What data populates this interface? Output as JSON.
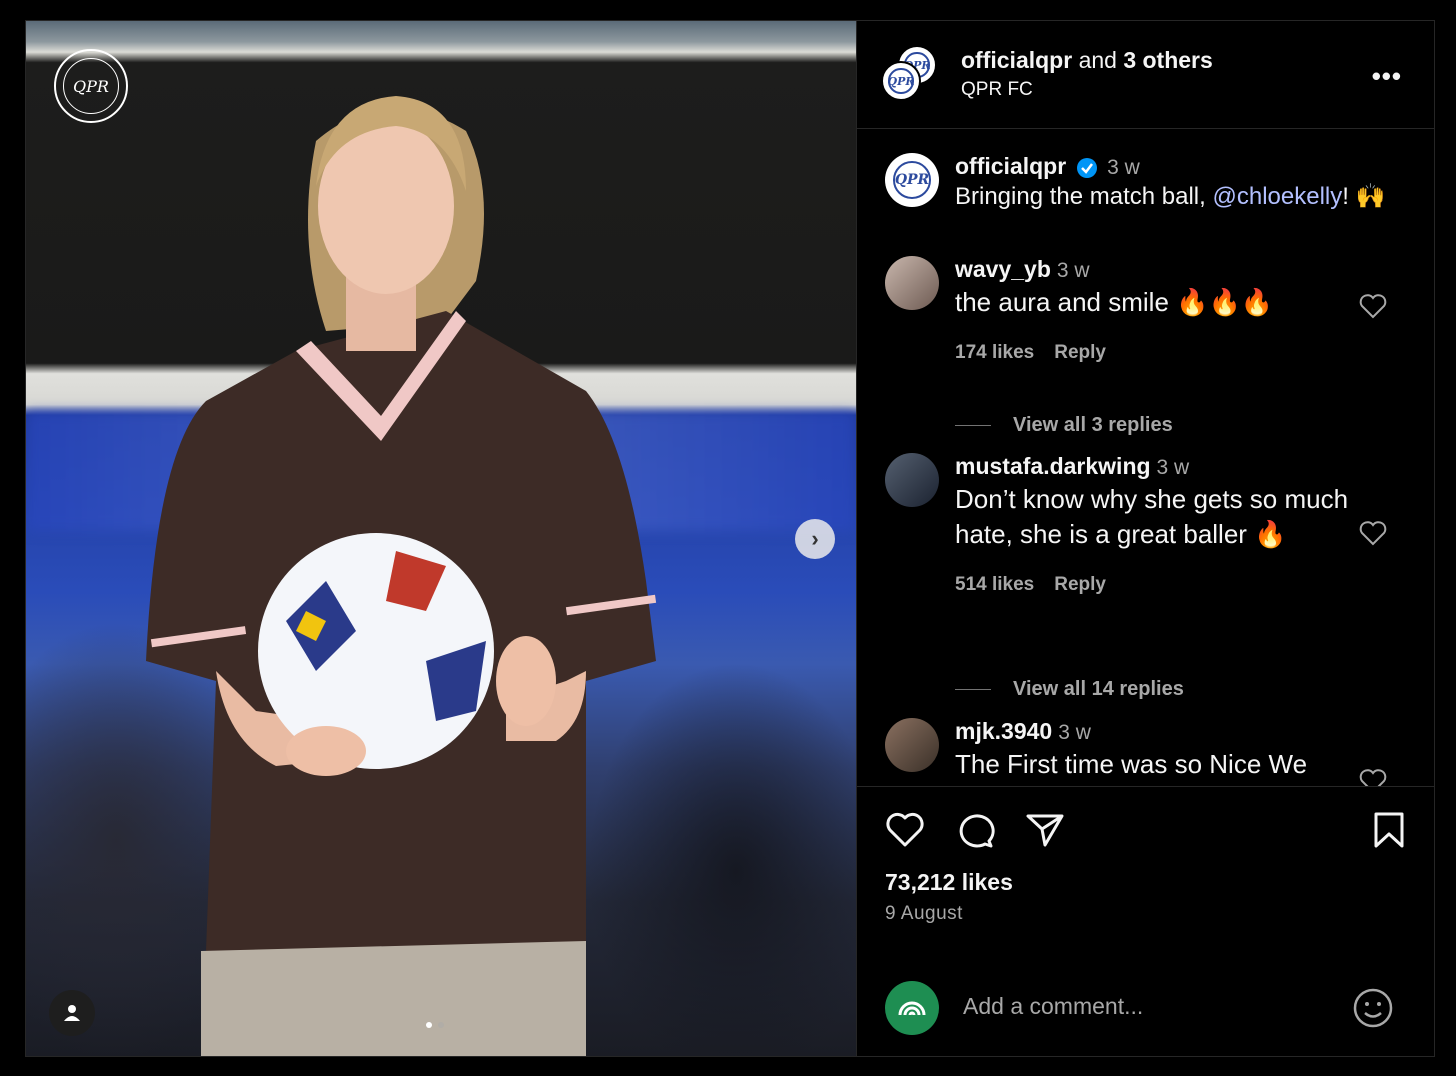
{
  "post": {
    "header": {
      "username": "officialqpr",
      "and_text": "and",
      "others": "3 others",
      "subtitle": "QPR FC"
    },
    "caption": {
      "username": "officialqpr",
      "time": "3 w",
      "text_before": "Bringing the match ball, ",
      "mention": "@chloekelly",
      "text_after": "! 🙌"
    },
    "comments": [
      {
        "username": "wavy_yb",
        "time": "3 w",
        "text": "the aura and smile 🔥🔥🔥",
        "likes": "174 likes",
        "reply": "Reply",
        "view_replies": "View all 3 replies"
      },
      {
        "username": "mustafa.darkwing",
        "time": "3 w",
        "text": "Don’t know why she gets so much hate, she is a great baller 🔥",
        "likes": "514 likes",
        "reply": "Reply",
        "view_replies": "View all 14 replies"
      },
      {
        "username": "mjk.3940",
        "time": "3 w",
        "text": "The First time was so Nice We"
      }
    ],
    "likes": "73,212 likes",
    "date": "9 August",
    "add_comment_placeholder": "Add a comment...",
    "photo_logo": "QPR"
  },
  "icons": [
    "more-options-icon",
    "verified-icon",
    "heart-icon",
    "comment-icon",
    "share-icon",
    "bookmark-icon",
    "emoji-icon",
    "user-tag-icon",
    "chevron-right-icon"
  ],
  "colors": {
    "background": "#000000",
    "mention": "#b3c0ff",
    "secondary_text": "#a8a8a8",
    "verified": "#0095f6"
  }
}
